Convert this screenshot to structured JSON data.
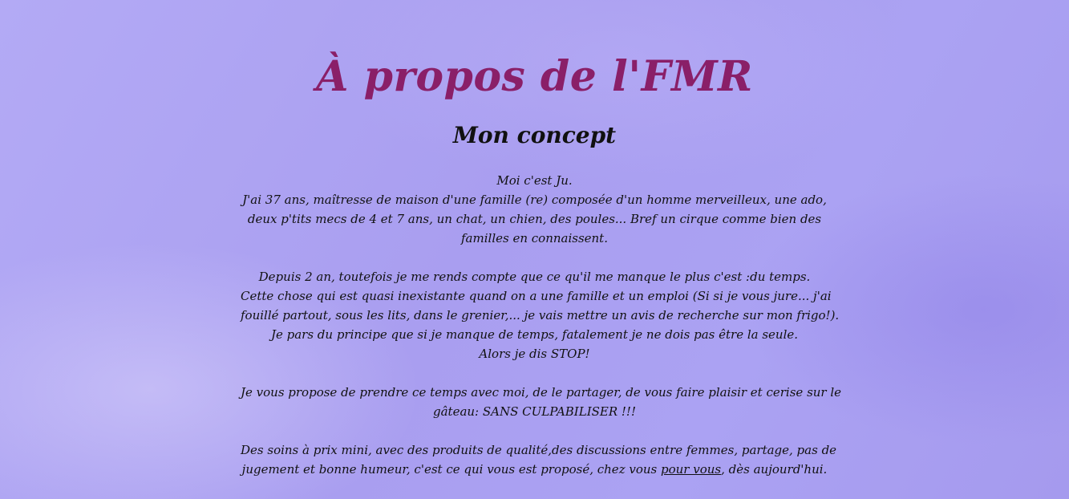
{
  "page": {
    "title": "À propos de l'FMR",
    "subtitle": "Mon concept"
  },
  "content": {
    "p1": [
      "Moi c'est Ju.",
      "J'ai 37 ans, maîtresse de maison d'une famille (re) composée d'un homme merveilleux, une ado,",
      "deux p'tits mecs de 4 et 7 ans, un chat, un chien, des poules... Bref un cirque comme bien des",
      "familles en connaissent."
    ],
    "p2": [
      "Depuis 2 an, toutefois je me rends compte que ce qu'il me manque le plus c'est :du temps.",
      "Cette chose qui est quasi inexistante quand on a une famille et un emploi (Si si je vous jure... j'ai",
      "fouillé partout, sous les lits, dans le grenier,... je vais mettre un avis de recherche sur mon frigo!).",
      "Je pars du principe que si je manque de temps, fatalement je ne dois pas être la seule.",
      "Alors je dis STOP!"
    ],
    "p3": [
      "Je vous propose de prendre ce temps avec moi, de le partager, de vous faire plaisir et cerise sur le",
      "gâteau: SANS CULPABILISER !!!"
    ],
    "p4": {
      "line1": "Des soins à prix mini, avec des produits de qualité,des discussions entre femmes, partage, pas de",
      "line2_before": "jugement et bonne humeur, c'est ce qui vous est proposé, chez vous ",
      "line2_underlined": "pour vous",
      "line2_after": ", dès aujourd'hui."
    }
  },
  "colors": {
    "background": "#ada3f2",
    "title": "#8a1f68",
    "text": "#111111"
  }
}
